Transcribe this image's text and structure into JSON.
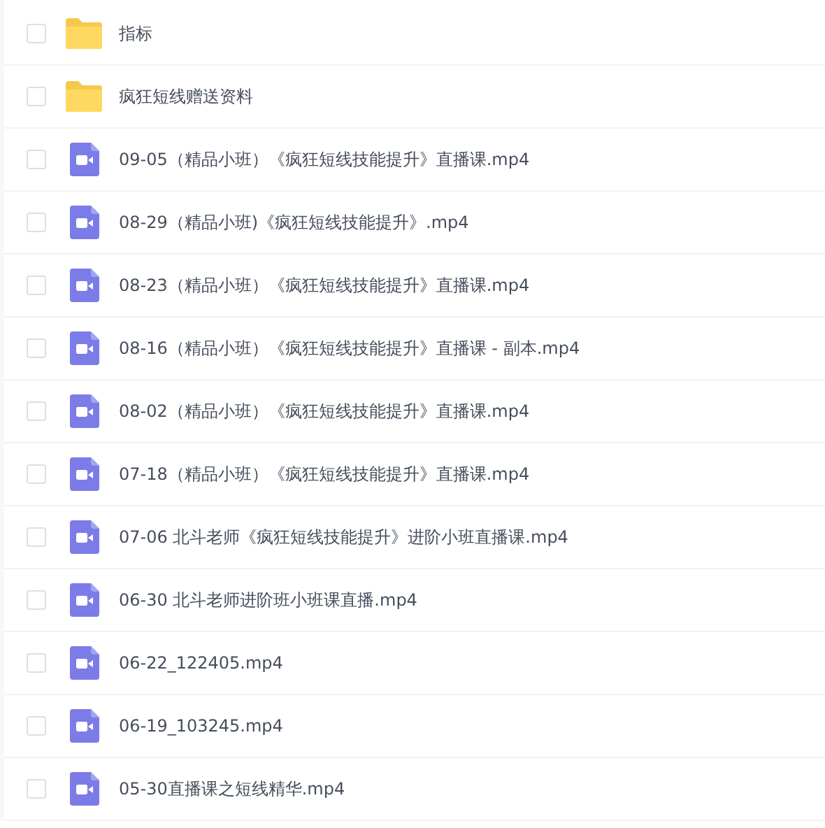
{
  "files": [
    {
      "kind": "folder",
      "name": "指标",
      "selected": false
    },
    {
      "kind": "folder",
      "name": "疯狂短线赠送资料",
      "selected": false
    },
    {
      "kind": "video",
      "name": "09-05（精品小班）《疯狂短线技能提升》直播课.mp4",
      "selected": false
    },
    {
      "kind": "video",
      "name": "08-29（精品小班)《疯狂短线技能提升》.mp4",
      "selected": false
    },
    {
      "kind": "video",
      "name": "08-23（精品小班）《疯狂短线技能提升》直播课.mp4",
      "selected": false
    },
    {
      "kind": "video",
      "name": "08-16（精品小班）《疯狂短线技能提升》直播课 - 副本.mp4",
      "selected": false
    },
    {
      "kind": "video",
      "name": "08-02（精品小班）《疯狂短线技能提升》直播课.mp4",
      "selected": false
    },
    {
      "kind": "video",
      "name": "07-18（精品小班）《疯狂短线技能提升》直播课.mp4",
      "selected": false
    },
    {
      "kind": "video",
      "name": "07-06 北斗老师《疯狂短线技能提升》进阶小班直播课.mp4",
      "selected": false
    },
    {
      "kind": "video",
      "name": "06-30 北斗老师进阶班小班课直播.mp4",
      "selected": false
    },
    {
      "kind": "video",
      "name": "06-22_122405.mp4",
      "selected": false
    },
    {
      "kind": "video",
      "name": "06-19_103245.mp4",
      "selected": false
    },
    {
      "kind": "video",
      "name": "05-30直播课之短线精华.mp4",
      "selected": false
    }
  ]
}
